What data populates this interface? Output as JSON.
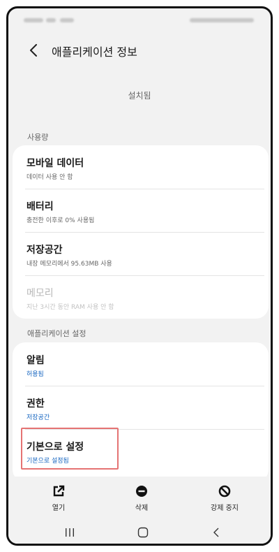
{
  "header": {
    "title": "애플리케이션 정보"
  },
  "app": {
    "name_partial": "ˉ ˉˉ ˉˉˉˉ ˉˉˉ",
    "install_status": "설치됨"
  },
  "usage": {
    "section_label": "사용량",
    "items": [
      {
        "title": "모바일 데이터",
        "subtitle": "데이터 사용 안 함"
      },
      {
        "title": "배터리",
        "subtitle": "충전한 이후로 0% 사용됨"
      },
      {
        "title": "저장공간",
        "subtitle": "내장 메모리에서 95.63MB 사용"
      },
      {
        "title": "메모리",
        "subtitle": "지난 3시간 동안 RAM 사용 안 함"
      }
    ]
  },
  "app_settings": {
    "section_label": "애플리케이션 설정",
    "items": [
      {
        "title": "알림",
        "subtitle": "허용됨"
      },
      {
        "title": "권한",
        "subtitle": "저장공간"
      },
      {
        "title": "기본으로 설정",
        "subtitle": "기본으로 설정됨"
      }
    ]
  },
  "actions": [
    {
      "label": "열기",
      "icon": "open-external-icon"
    },
    {
      "label": "삭제",
      "icon": "delete-minus-icon"
    },
    {
      "label": "강제 중지",
      "icon": "block-icon"
    }
  ],
  "nav": {
    "icons": [
      "recent-apps-icon",
      "home-icon",
      "back-icon"
    ]
  },
  "colors": {
    "accent_blue": "#1565c0",
    "highlight_red": "#e57373"
  }
}
